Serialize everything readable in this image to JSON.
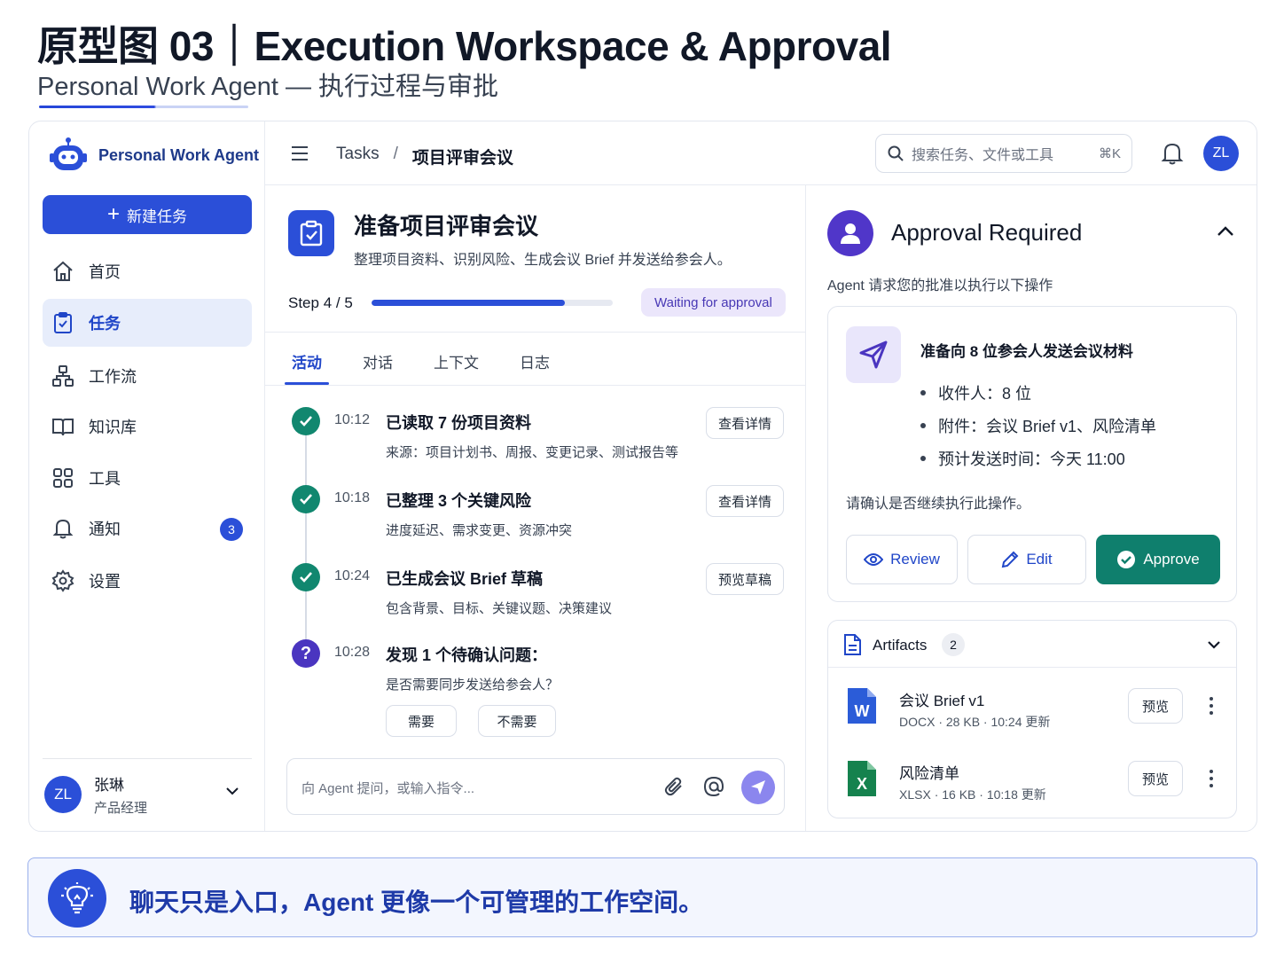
{
  "header": {
    "title": "原型图 03｜Execution Workspace & Approval",
    "subtitle": "Personal Work Agent — 执行过程与审批"
  },
  "sidebar": {
    "brand": "Personal Work Agent",
    "new_task": "新建任务",
    "items": [
      {
        "label": "首页",
        "icon": "home-icon"
      },
      {
        "label": "任务",
        "icon": "clipboard-check-icon",
        "active": true
      },
      {
        "label": "工作流",
        "icon": "workflow-icon"
      },
      {
        "label": "知识库",
        "icon": "book-icon"
      },
      {
        "label": "工具",
        "icon": "grid-icon"
      },
      {
        "label": "通知",
        "icon": "bell-icon",
        "badge": "3"
      },
      {
        "label": "设置",
        "icon": "gear-icon"
      }
    ],
    "user": {
      "initials": "ZL",
      "name": "张琳",
      "role": "产品经理"
    }
  },
  "topbar": {
    "breadcrumb": {
      "root": "Tasks",
      "separator": "/",
      "current": "项目评审会议"
    },
    "search_placeholder": "搜索任务、文件或工具",
    "search_shortcut": "⌘K",
    "avatar_initials": "ZL"
  },
  "task": {
    "title": "准备项目评审会议",
    "description": "整理项目资料、识别风险、生成会议 Brief 并发送给参会人。",
    "step_label": "Step 4 / 5",
    "progress": 0.8,
    "status": "Waiting for approval",
    "tabs": [
      "活动",
      "对话",
      "上下文",
      "日志"
    ],
    "timeline": [
      {
        "time": "10:12",
        "title": "已读取 7 份项目资料",
        "sub": "来源：项目计划书、周报、变更记录、测试报告等",
        "button": "查看详情",
        "state": "done"
      },
      {
        "time": "10:18",
        "title": "已整理 3 个关键风险",
        "sub": "进度延迟、需求变更、资源冲突",
        "button": "查看详情",
        "state": "done"
      },
      {
        "time": "10:24",
        "title": "已生成会议 Brief 草稿",
        "sub": "包含背景、目标、关键议题、决策建议",
        "button": "预览草稿",
        "state": "done"
      },
      {
        "time": "10:28",
        "title": "发现 1 个待确认问题：",
        "sub": "是否需要同步发送给参会人？",
        "state": "question"
      }
    ],
    "choices": {
      "yes": "需要",
      "no": "不需要"
    },
    "input_placeholder": "向 Agent 提问，或输入指令..."
  },
  "approval": {
    "title": "Approval Required",
    "description": "Agent 请求您的批准以执行以下操作",
    "card_title": "准备向 8 位参会人发送会议材料",
    "bullets": [
      "收件人：8 位",
      "附件：会议 Brief v1、风险清单",
      "预计发送时间：今天 11:00"
    ],
    "confirm": "请确认是否继续执行此操作。",
    "review": "Review",
    "edit": "Edit",
    "approve": "Approve",
    "accent": "#0f7f6d"
  },
  "artifacts": {
    "title": "Artifacts",
    "count": "2",
    "files": [
      {
        "name": "会议 Brief v1",
        "meta": "DOCX · 28 KB · 10:24 更新",
        "type": "word",
        "letter": "W",
        "action": "预览"
      },
      {
        "name": "风险清单",
        "meta": "XLSX · 16 KB · 10:18 更新",
        "type": "excel",
        "letter": "X",
        "action": "预览"
      }
    ]
  },
  "banner": {
    "text": "聊天只是入口，Agent 更像一个可管理的工作空间。"
  },
  "colors": {
    "primary": "#2b4fd8",
    "success": "#11876f",
    "purple": "#5036c9"
  }
}
